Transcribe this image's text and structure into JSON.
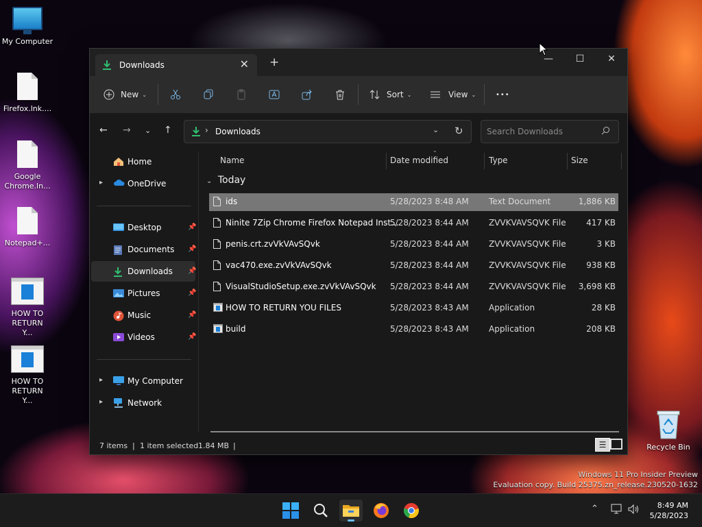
{
  "desktop": {
    "icons": [
      {
        "label": "My Computer"
      },
      {
        "label": "Firefox.lnk...."
      },
      {
        "label": "Google Chrome.ln..."
      },
      {
        "label": "Notepad+..."
      },
      {
        "label": "HOW TO RETURN Y..."
      },
      {
        "label": "HOW TO RETURN Y..."
      }
    ],
    "recycle_bin": "Recycle Bin",
    "watermark_line1": "Windows 11 Pro Insider Preview",
    "watermark_line2": "Evaluation copy. Build 25375.zn_release.230520-1632"
  },
  "window": {
    "tab_title": "Downloads",
    "new_tab": "+",
    "controls": {
      "minimize": "—",
      "maximize": "☐",
      "close": "✕"
    }
  },
  "toolbar": {
    "new_label": "New",
    "sort_label": "Sort",
    "view_label": "View",
    "more_label": "•••"
  },
  "address": {
    "path": "Downloads",
    "search_placeholder": "Search Downloads"
  },
  "sidebar": {
    "items": [
      {
        "label": "Home"
      },
      {
        "label": "OneDrive"
      },
      {
        "label": "Desktop"
      },
      {
        "label": "Documents"
      },
      {
        "label": "Downloads"
      },
      {
        "label": "Pictures"
      },
      {
        "label": "Music"
      },
      {
        "label": "Videos"
      },
      {
        "label": "My Computer"
      },
      {
        "label": "Network"
      }
    ]
  },
  "files": {
    "columns": [
      "Name",
      "Date modified",
      "Type",
      "Size"
    ],
    "group": "Today",
    "rows": [
      {
        "name": "ids",
        "date": "5/28/2023 8:48 AM",
        "type": "Text Document",
        "size": "1,886 KB"
      },
      {
        "name": "Ninite 7Zip Chrome Firefox Notepad Inst...",
        "date": "5/28/2023 8:44 AM",
        "type": "ZVVKVAVSQVK File",
        "size": "417 KB"
      },
      {
        "name": "penis.crt.zvVkVAvSQvk",
        "date": "5/28/2023 8:44 AM",
        "type": "ZVVKVAVSQVK File",
        "size": "3 KB"
      },
      {
        "name": "vac470.exe.zvVkVAvSQvk",
        "date": "5/28/2023 8:44 AM",
        "type": "ZVVKVAVSQVK File",
        "size": "938 KB"
      },
      {
        "name": "VisualStudioSetup.exe.zvVkVAvSQvk",
        "date": "5/28/2023 8:44 AM",
        "type": "ZVVKVAVSQVK File",
        "size": "3,698 KB"
      },
      {
        "name": "HOW TO RETURN YOU FILES",
        "date": "5/28/2023 8:43 AM",
        "type": "Application",
        "size": "28 KB"
      },
      {
        "name": "build",
        "date": "5/28/2023 8:43 AM",
        "type": "Application",
        "size": "208 KB"
      }
    ]
  },
  "status": {
    "count": "7 items",
    "sep": "|",
    "selected": "1 item selected",
    "size": "1.84 MB"
  },
  "taskbar": {
    "time": "8:49 AM",
    "date": "5/28/2023"
  },
  "colors": {
    "accent": "#6cc0ff",
    "download_green": "#2fbf71",
    "selection": "#777777"
  }
}
